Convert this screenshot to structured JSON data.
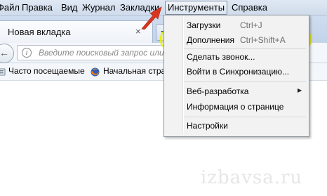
{
  "menubar": {
    "items": [
      "Файл",
      "Правка",
      "Вид",
      "Журнал",
      "Закладки",
      "Инструменты",
      "Справка"
    ]
  },
  "tabs": {
    "active_title": "Новая вкладка",
    "close_glyph": "×",
    "new_tab_glyph": "+"
  },
  "navbar": {
    "back_glyph": "←",
    "info_glyph": "i",
    "search_placeholder": "Введите поисковый запрос или"
  },
  "bookmarks": {
    "items": [
      "Часто посещаемые",
      "Начальная страница"
    ]
  },
  "tools_menu": {
    "items": [
      {
        "label": "Загрузки",
        "shortcut": "Ctrl+J"
      },
      {
        "label": "Дополнения",
        "shortcut": "Ctrl+Shift+A",
        "highlighted": true
      },
      {
        "label": "Сделать звонок...",
        "shortcut": ""
      },
      {
        "label": "Войти в Синхронизацию...",
        "shortcut": ""
      },
      {
        "label": "Веб-разработка",
        "shortcut": "",
        "submenu": true
      },
      {
        "label": "Информация о странице",
        "shortcut": ""
      },
      {
        "label": "Настройки",
        "shortcut": ""
      }
    ],
    "submenu_glyph": "▶"
  },
  "annotation": {
    "highlight_color": "#e9ee18",
    "arrow_color": "#d8361f"
  },
  "watermark": "izbavsa.ru"
}
